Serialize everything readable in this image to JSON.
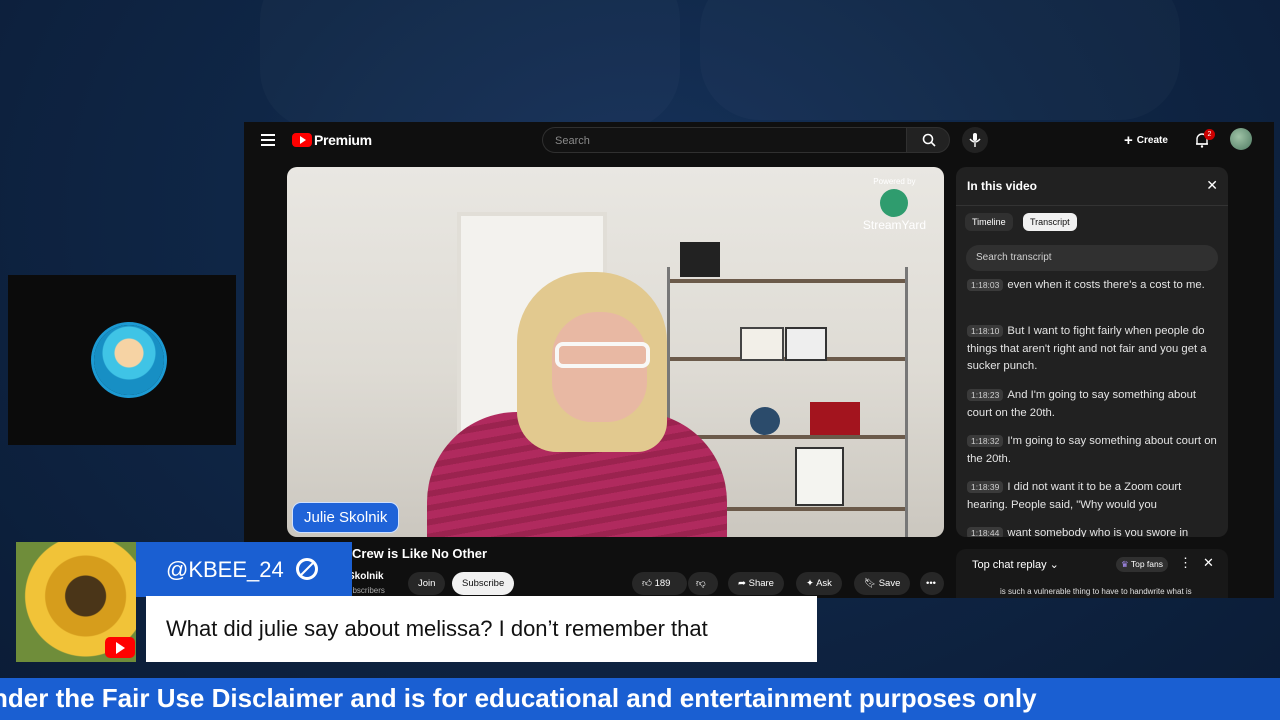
{
  "youtube": {
    "brand": "Premium",
    "search_placeholder": "Search",
    "create_label": "Create",
    "notification_count": "2",
    "video": {
      "name_tag": "Julie Skolnik",
      "powered_by": "Powered by",
      "powered_brand": "StreamYard"
    },
    "below_video": {
      "title_fragment": "Crew is Like No Other",
      "channel_fragment": "Skolnik",
      "subscribers_fragment": "ubscribers",
      "join_label": "Join",
      "subscribe_label": "Subscribe",
      "like_count": "189",
      "share_label": "Share",
      "ask_label": "Ask",
      "save_label": "Save"
    },
    "panel": {
      "title": "In this video",
      "tabs": [
        "Timeline",
        "Transcript"
      ],
      "search_placeholder": "Search transcript",
      "lines": [
        {
          "time": "1:18:03",
          "text": "even when it costs there's a cost to me."
        },
        {
          "time": "1:18:10",
          "text": "But I want to fight fairly when people do things that aren't right and not fair and you get a sucker punch."
        },
        {
          "time": "1:18:23",
          "text": "And I'm going to say something about court on the 20th."
        },
        {
          "time": "1:18:32",
          "text": "I'm going to say something about court on the 20th."
        },
        {
          "time": "1:18:39",
          "text": "I did not want it to be a Zoom court hearing. People said, \"Why would you"
        },
        {
          "time": "1:18:44",
          "text": "want somebody who is you swore in"
        }
      ]
    },
    "chat": {
      "label": "Top chat replay",
      "top_fans": "Top fans",
      "message": "is such a vulnerable thing to have to handwrite what is"
    }
  },
  "overlay": {
    "handle": "@KBEE_24",
    "comment": "What did julie say about melissa? I don’t remember that",
    "ticker": "nder the Fair Use Disclaimer and is for educational and entertainment purposes only"
  }
}
